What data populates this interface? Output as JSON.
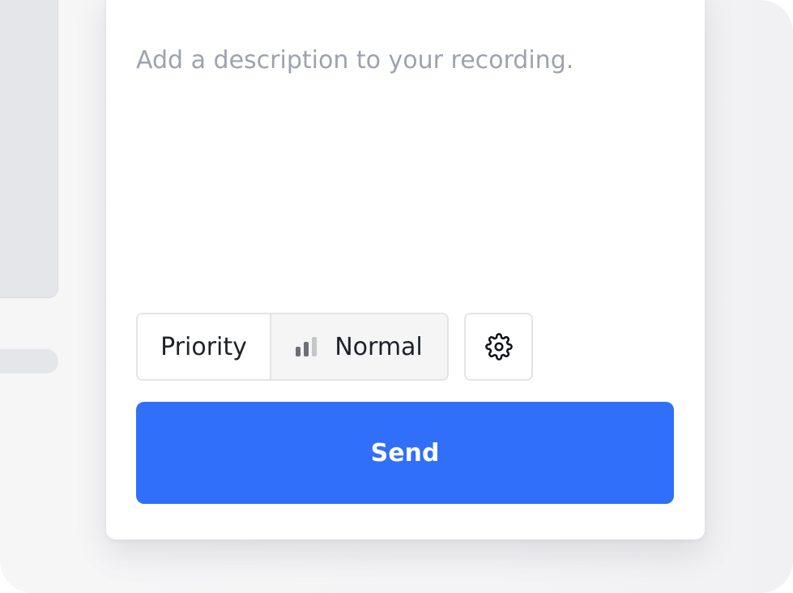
{
  "description": {
    "value": "",
    "placeholder": "Add a description to your recording."
  },
  "priority": {
    "label": "Priority",
    "selected_value": "Normal",
    "icon": "signal-bars-icon"
  },
  "settings": {
    "icon": "gear-icon"
  },
  "send": {
    "label": "Send"
  },
  "colors": {
    "accent": "#2f6ffa",
    "placeholder": "#9ea2af",
    "border": "#e3e4e8",
    "text": "#1d2129"
  }
}
